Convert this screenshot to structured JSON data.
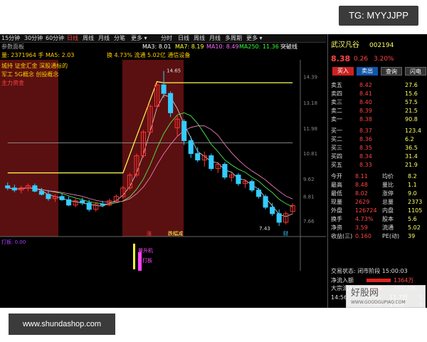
{
  "badges": {
    "telegram": "TG: MYYJJPP",
    "site": "www.shundashop.com"
  },
  "toolbar": {
    "left_items": [
      "15分钟",
      "30分钟",
      "60分钟",
      "日线",
      "周线",
      "月线",
      "分笔",
      "更多 ▾"
    ],
    "colors": {
      "menu_text": "#dddddd"
    }
  },
  "tabs": {
    "items": [
      "分时",
      "日线",
      "周线",
      "月线",
      "多周期",
      "更多 ▾"
    ]
  },
  "indicators": {
    "title_left": "参数面板",
    "ma_items": [
      {
        "text": "MA3: 8.01",
        "color": "#ffffff"
      },
      {
        "text": "MA7: 8.19",
        "color": "#ffff33"
      },
      {
        "text": "MA10: 8.49",
        "color": "#ff66ff"
      },
      {
        "text": "MA250: 11.36",
        "color": "#33ff33"
      },
      {
        "text": "突破线",
        "color": "#ffffff"
      }
    ],
    "line2": "量: 2371964 手  MA5: 2.03",
    "line3": "换 4.73%  流通 5.02亿  通信设备",
    "notes": [
      "城持 证金汇金 深股通标的",
      "军工 5G概念 创投概念"
    ],
    "red_label": "主力资金",
    "bottom_labels": [
      "涨",
      "跌幅减",
      "财"
    ]
  },
  "price_axis": [
    "14.39",
    "13.18",
    "11.98",
    "10.81",
    "9.62",
    "8.81",
    "7.66"
  ],
  "chart_labels": {
    "high": "14.65",
    "low": "7.43"
  },
  "subchart": {
    "title": "打板: 0.00",
    "label_a": "量升机",
    "label_b": "打板"
  },
  "quote": {
    "name": "武汉凡谷",
    "code": "002194",
    "price": "8.38",
    "change": "0.26",
    "pct": "3.20%",
    "buttons": [
      "买入",
      "卖出",
      "查询",
      "闪电"
    ],
    "asks": [
      {
        "label": "卖五",
        "price": "8.42",
        "vol": "27.6"
      },
      {
        "label": "卖四",
        "price": "8.41",
        "vol": "15.6"
      },
      {
        "label": "卖三",
        "price": "8.40",
        "vol": "57.5"
      },
      {
        "label": "卖二",
        "price": "8.39",
        "vol": "21.5"
      },
      {
        "label": "卖一",
        "price": "8.38",
        "vol": "90.8"
      }
    ],
    "bids": [
      {
        "label": "买一",
        "price": "8.37",
        "vol": "123.4"
      },
      {
        "label": "买二",
        "price": "8.36",
        "vol": "6.2"
      },
      {
        "label": "买三",
        "price": "8.35",
        "vol": "36.5"
      },
      {
        "label": "买四",
        "price": "8.34",
        "vol": "31.4"
      },
      {
        "label": "买五",
        "price": "8.33",
        "vol": "21.9"
      }
    ],
    "stats": [
      {
        "l1": "今开",
        "v1": "8.11",
        "l2": "均价",
        "v2": "8.2"
      },
      {
        "l1": "最高",
        "v1": "8.48",
        "l2": "量比",
        "v2": "1.1"
      },
      {
        "l1": "最低",
        "v1": "8.02",
        "l2": "涨停",
        "v2": "9.0"
      },
      {
        "l1": "现量",
        "v1": "2629",
        "l2": "总量",
        "v2": "2373"
      },
      {
        "l1": "外盘",
        "v1": "126724",
        "l2": "内盘",
        "v2": "1105"
      },
      {
        "l1": "换手",
        "v1": "4.73%",
        "l2": "股本",
        "v2": "5.6"
      },
      {
        "l1": "净资",
        "v1": "3.59",
        "l2": "流通",
        "v2": "5.02"
      },
      {
        "l1": "收益(三)",
        "v1": "0.160",
        "l2": "PE(动)",
        "v2": "39"
      }
    ],
    "status": "交易状态: 闭市阶段 15:00:03",
    "flows": [
      {
        "label": "净流入额",
        "value": "1364万"
      },
      {
        "label": "大宗流入",
        "value": "707.3万"
      }
    ],
    "ticks": [
      {
        "time": "14:56",
        "price": "8.38",
        "vol": "11.7万",
        "flag": "S"
      },
      {
        "time": "",
        "price": "8.38",
        "vol": "1.0万",
        "flag": "B"
      },
      {
        "time": "",
        "price": "8.37",
        "vol": "6.8万",
        "flag": "S"
      }
    ]
  },
  "watermark": {
    "title": "好股网",
    "url": "WWW.GOODGUPIAO.COM"
  },
  "chart_data": {
    "type": "candlestick",
    "candles": [
      {
        "o": 9.3,
        "h": 9.45,
        "l": 9.1,
        "c": 9.2
      },
      {
        "o": 9.2,
        "h": 9.35,
        "l": 9.0,
        "c": 9.1
      },
      {
        "o": 9.1,
        "h": 9.3,
        "l": 8.95,
        "c": 9.2
      },
      {
        "o": 9.2,
        "h": 9.4,
        "l": 9.05,
        "c": 9.3
      },
      {
        "o": 9.3,
        "h": 9.4,
        "l": 9.0,
        "c": 9.05
      },
      {
        "o": 9.05,
        "h": 9.2,
        "l": 8.85,
        "c": 8.9
      },
      {
        "o": 8.9,
        "h": 9.1,
        "l": 8.6,
        "c": 8.7
      },
      {
        "o": 8.7,
        "h": 8.9,
        "l": 8.55,
        "c": 8.8
      },
      {
        "o": 8.8,
        "h": 8.95,
        "l": 8.6,
        "c": 8.65
      },
      {
        "o": 8.65,
        "h": 8.8,
        "l": 8.35,
        "c": 8.4
      },
      {
        "o": 8.4,
        "h": 8.7,
        "l": 8.3,
        "c": 8.6
      },
      {
        "o": 8.6,
        "h": 8.75,
        "l": 8.4,
        "c": 8.5
      },
      {
        "o": 8.5,
        "h": 8.65,
        "l": 8.1,
        "c": 8.2
      },
      {
        "o": 8.2,
        "h": 8.5,
        "l": 8.1,
        "c": 8.45
      },
      {
        "o": 8.45,
        "h": 8.6,
        "l": 8.3,
        "c": 8.4
      },
      {
        "o": 8.4,
        "h": 8.7,
        "l": 8.35,
        "c": 8.6
      },
      {
        "o": 8.6,
        "h": 8.9,
        "l": 8.5,
        "c": 8.8
      },
      {
        "o": 8.8,
        "h": 9.3,
        "l": 8.7,
        "c": 9.2
      },
      {
        "o": 9.2,
        "h": 9.9,
        "l": 9.1,
        "c": 9.8
      },
      {
        "o": 9.8,
        "h": 10.8,
        "l": 9.7,
        "c": 10.7
      },
      {
        "o": 10.7,
        "h": 11.9,
        "l": 10.6,
        "c": 11.8
      },
      {
        "o": 11.8,
        "h": 13.1,
        "l": 11.7,
        "c": 13.0
      },
      {
        "o": 13.0,
        "h": 14.1,
        "l": 12.9,
        "c": 14.0
      },
      {
        "o": 14.0,
        "h": 14.65,
        "l": 13.4,
        "c": 13.6
      },
      {
        "o": 13.6,
        "h": 13.7,
        "l": 12.5,
        "c": 12.7
      },
      {
        "o": 12.0,
        "h": 12.6,
        "l": 11.6,
        "c": 12.4
      },
      {
        "o": 12.3,
        "h": 12.4,
        "l": 11.2,
        "c": 11.4
      },
      {
        "o": 11.4,
        "h": 11.6,
        "l": 10.6,
        "c": 10.8
      },
      {
        "o": 10.8,
        "h": 11.1,
        "l": 10.4,
        "c": 10.5
      },
      {
        "o": 10.5,
        "h": 10.9,
        "l": 10.2,
        "c": 10.7
      },
      {
        "o": 10.7,
        "h": 10.8,
        "l": 10.0,
        "c": 10.1
      },
      {
        "o": 10.1,
        "h": 10.4,
        "l": 9.9,
        "c": 10.3
      },
      {
        "o": 10.3,
        "h": 10.4,
        "l": 9.6,
        "c": 9.7
      },
      {
        "o": 9.7,
        "h": 9.9,
        "l": 9.5,
        "c": 9.8
      },
      {
        "o": 9.8,
        "h": 9.9,
        "l": 9.3,
        "c": 9.4
      },
      {
        "o": 9.4,
        "h": 9.6,
        "l": 9.2,
        "c": 9.5
      },
      {
        "o": 9.5,
        "h": 9.6,
        "l": 9.0,
        "c": 9.1
      },
      {
        "o": 9.1,
        "h": 9.2,
        "l": 8.7,
        "c": 8.8
      },
      {
        "o": 8.8,
        "h": 8.9,
        "l": 8.2,
        "c": 8.3
      },
      {
        "o": 8.3,
        "h": 8.5,
        "l": 7.9,
        "c": 8.0
      },
      {
        "o": 8.0,
        "h": 8.2,
        "l": 7.43,
        "c": 7.6
      },
      {
        "o": 7.6,
        "h": 8.1,
        "l": 7.5,
        "c": 8.0
      },
      {
        "o": 8.1,
        "h": 8.48,
        "l": 8.02,
        "c": 8.38
      }
    ],
    "ylim": [
      7.2,
      14.9
    ],
    "colors": {
      "up": "#ff3333",
      "down": "#33ccff",
      "bg_band": "#5a1010",
      "ma_yellow": "#ffff55",
      "ma_green": "#55ff55",
      "ma_white": "#dddddd",
      "ma_pink": "#ff88cc"
    }
  }
}
